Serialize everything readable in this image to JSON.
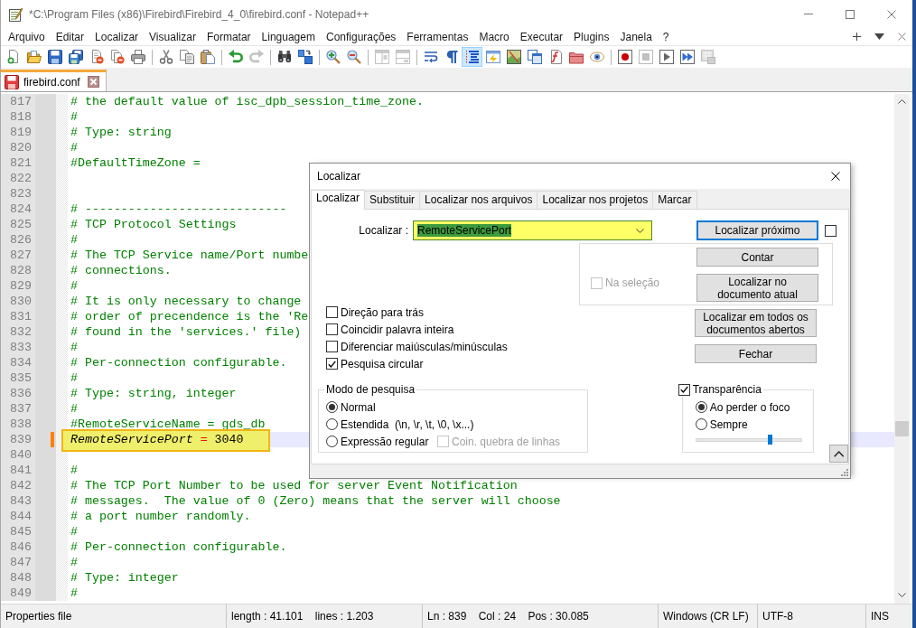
{
  "window": {
    "title": "*C:\\Program Files (x86)\\Firebird\\Firebird_4_0\\firebird.conf - Notepad++"
  },
  "menu": [
    "Arquivo",
    "Editar",
    "Localizar",
    "Visualizar",
    "Formatar",
    "Linguagem",
    "Configurações",
    "Ferramentas",
    "Macro",
    "Executar",
    "Plugins",
    "Janela",
    "?"
  ],
  "toolbar": [
    {
      "buttons": [
        {
          "kind": "new",
          "on": false,
          "disabled": false
        },
        {
          "kind": "open",
          "on": false,
          "disabled": false
        },
        {
          "kind": "save",
          "on": false,
          "disabled": false
        },
        {
          "kind": "saveall",
          "on": false,
          "disabled": false
        },
        {
          "kind": "close",
          "on": false,
          "disabled": false
        },
        {
          "kind": "closeall",
          "on": false,
          "disabled": false
        },
        {
          "kind": "print",
          "on": false,
          "disabled": false
        }
      ]
    },
    {
      "buttons": [
        {
          "kind": "cut",
          "on": false,
          "disabled": false
        },
        {
          "kind": "copy",
          "on": false,
          "disabled": false
        },
        {
          "kind": "paste",
          "on": false,
          "disabled": false
        }
      ]
    },
    {
      "buttons": [
        {
          "kind": "undo",
          "on": false,
          "disabled": false
        },
        {
          "kind": "redo",
          "on": false,
          "disabled": true
        }
      ]
    },
    {
      "buttons": [
        {
          "kind": "find",
          "on": false,
          "disabled": false
        },
        {
          "kind": "replace",
          "on": false,
          "disabled": false
        }
      ]
    },
    {
      "buttons": [
        {
          "kind": "zoomin",
          "on": false,
          "disabled": false
        },
        {
          "kind": "zoomout",
          "on": false,
          "disabled": false
        }
      ]
    },
    {
      "buttons": [
        {
          "kind": "syncv",
          "on": false,
          "disabled": true
        },
        {
          "kind": "synch",
          "on": false,
          "disabled": true
        }
      ]
    },
    {
      "buttons": [
        {
          "kind": "wrap",
          "on": false,
          "disabled": false
        },
        {
          "kind": "allchars",
          "on": false,
          "disabled": false
        },
        {
          "kind": "indent",
          "on": true,
          "disabled": false
        },
        {
          "kind": "udl",
          "on": false,
          "disabled": false
        },
        {
          "kind": "docmap",
          "on": false,
          "disabled": false
        },
        {
          "kind": "doclist",
          "on": false,
          "disabled": false
        },
        {
          "kind": "funclist",
          "on": false,
          "disabled": false
        },
        {
          "kind": "workspace",
          "on": false,
          "disabled": false
        },
        {
          "kind": "monitor",
          "on": false,
          "disabled": false
        }
      ]
    },
    {
      "buttons": [
        {
          "kind": "record",
          "on": false,
          "disabled": false
        },
        {
          "kind": "stop",
          "on": false,
          "disabled": true
        },
        {
          "kind": "play",
          "on": false,
          "disabled": false
        },
        {
          "kind": "playmulti",
          "on": false,
          "disabled": false
        },
        {
          "kind": "savemacro",
          "on": false,
          "disabled": true
        }
      ]
    }
  ],
  "doc_tabs": [
    {
      "label": "firebird.conf",
      "selected": true,
      "modified": true
    }
  ],
  "editor": {
    "lines": [
      {
        "number": "817",
        "kind": "comment",
        "text": "# the default value of isc_dpb_session_time_zone.",
        "current": false,
        "modified": false,
        "highlighted": false
      },
      {
        "number": "818",
        "kind": "comment",
        "text": "#",
        "current": false,
        "modified": false,
        "highlighted": false
      },
      {
        "number": "819",
        "kind": "comment",
        "text": "# Type: string",
        "current": false,
        "modified": false,
        "highlighted": false
      },
      {
        "number": "820",
        "kind": "comment",
        "text": "#",
        "current": false,
        "modified": false,
        "highlighted": false
      },
      {
        "number": "821",
        "kind": "comment",
        "text": "#DefaultTimeZone =",
        "current": false,
        "modified": false,
        "highlighted": false
      },
      {
        "number": "822",
        "kind": "blank",
        "current": false,
        "modified": false,
        "highlighted": false
      },
      {
        "number": "823",
        "kind": "blank",
        "current": false,
        "modified": false,
        "highlighted": false
      },
      {
        "number": "824",
        "kind": "comment",
        "text": "# ----------------------------",
        "current": false,
        "modified": false,
        "highlighted": false
      },
      {
        "number": "825",
        "kind": "comment",
        "text": "# TCP Protocol Settings",
        "current": false,
        "modified": false,
        "highlighted": false
      },
      {
        "number": "826",
        "kind": "comment",
        "text": "#",
        "current": false,
        "modified": false,
        "highlighted": false
      },
      {
        "number": "827",
        "kind": "comment",
        "text": "# The TCP Service name/Port numbe",
        "current": false,
        "modified": false,
        "highlighted": false
      },
      {
        "number": "828",
        "kind": "comment",
        "text": "# connections.",
        "current": false,
        "modified": false,
        "highlighted": false
      },
      {
        "number": "829",
        "kind": "comment",
        "text": "#",
        "current": false,
        "modified": false,
        "highlighted": false
      },
      {
        "number": "830",
        "kind": "comment",
        "text": "# It is only necessary to change",
        "current": false,
        "modified": false,
        "highlighted": false
      },
      {
        "number": "831",
        "kind": "comment",
        "text": "# order of precendence is the 'Re",
        "current": false,
        "modified": false,
        "highlighted": false
      },
      {
        "number": "832",
        "kind": "comment",
        "text": "# found in the 'services.' file)",
        "current": false,
        "modified": false,
        "highlighted": false
      },
      {
        "number": "833",
        "kind": "comment",
        "text": "#",
        "current": false,
        "modified": false,
        "highlighted": false
      },
      {
        "number": "834",
        "kind": "comment",
        "text": "# Per-connection configurable.",
        "current": false,
        "modified": false,
        "highlighted": false
      },
      {
        "number": "835",
        "kind": "comment",
        "text": "#",
        "current": false,
        "modified": false,
        "highlighted": false
      },
      {
        "number": "836",
        "kind": "comment",
        "text": "# Type: string, integer",
        "current": false,
        "modified": false,
        "highlighted": false
      },
      {
        "number": "837",
        "kind": "comment",
        "text": "#",
        "current": false,
        "modified": false,
        "highlighted": false
      },
      {
        "number": "838",
        "kind": "comment",
        "text": "#RemoteServiceName = gds_db",
        "current": false,
        "modified": false,
        "highlighted": false
      },
      {
        "number": "839",
        "kind": "property",
        "parts": [
          {
            "kind": "key",
            "text": "RemoteServicePort"
          },
          {
            "kind": "operator",
            "text": " = "
          },
          {
            "kind": "value",
            "text": "3040"
          }
        ],
        "current": true,
        "modified": true,
        "highlighted": true
      },
      {
        "number": "840",
        "kind": "blank",
        "current": false,
        "modified": false,
        "highlighted": false
      },
      {
        "number": "841",
        "kind": "comment",
        "text": "#",
        "current": false,
        "modified": false,
        "highlighted": false
      },
      {
        "number": "842",
        "kind": "comment",
        "text": "# The TCP Port Number to be used for server Event Notification",
        "current": false,
        "modified": false,
        "highlighted": false
      },
      {
        "number": "843",
        "kind": "comment",
        "text": "# messages.  The value of 0 (Zero) means that the server will choose",
        "current": false,
        "modified": false,
        "highlighted": false
      },
      {
        "number": "844",
        "kind": "comment",
        "text": "# a port number randomly.",
        "current": false,
        "modified": false,
        "highlighted": false
      },
      {
        "number": "845",
        "kind": "comment",
        "text": "#",
        "current": false,
        "modified": false,
        "highlighted": false
      },
      {
        "number": "846",
        "kind": "comment",
        "text": "# Per-connection configurable.",
        "current": false,
        "modified": false,
        "highlighted": false
      },
      {
        "number": "847",
        "kind": "comment",
        "text": "#",
        "current": false,
        "modified": false,
        "highlighted": false
      },
      {
        "number": "848",
        "kind": "comment",
        "text": "# Type: integer",
        "current": false,
        "modified": false,
        "highlighted": false
      },
      {
        "number": "849",
        "kind": "comment",
        "text": "#",
        "current": false,
        "modified": false,
        "highlighted": false
      }
    ]
  },
  "find_dialog": {
    "title": "Localizar",
    "tabs": [
      {
        "label": "Localizar",
        "selected": true
      },
      {
        "label": "Substituir",
        "selected": false
      },
      {
        "label": "Localizar nos arquivos",
        "selected": false
      },
      {
        "label": "Localizar nos projetos",
        "selected": false
      },
      {
        "label": "Marcar",
        "selected": false
      }
    ],
    "search": {
      "label": "Localizar :",
      "value": "RemoteServicePort",
      "text_selected": true
    },
    "two_button_mode": {
      "checked": false
    },
    "in_selection": {
      "label": "Na seleção",
      "checked": false,
      "disabled": true
    },
    "buttons": {
      "find_next": {
        "label": "Localizar próximo",
        "default": true
      },
      "count": {
        "label": "Contar",
        "default": false
      },
      "find_all_current": {
        "label": "Localizar no documento atual",
        "default": false
      },
      "find_all_open": {
        "label": "Localizar em todos os documentos abertos",
        "default": false
      },
      "close": {
        "label": "Fechar",
        "default": false
      }
    },
    "options": [
      {
        "label": "Direção para trás",
        "checked": false
      },
      {
        "label": "Coincidir palavra inteira",
        "checked": false
      },
      {
        "label": "Diferenciar maiúsculas/minúsculas",
        "checked": false
      },
      {
        "label": "Pesquisa circular",
        "checked": true
      }
    ],
    "search_mode": {
      "title": "Modo de pesquisa",
      "options": [
        {
          "label": "Normal",
          "selected": true
        },
        {
          "label": "Estendida  (\\n, \\r, \\t, \\0, \\x...)",
          "selected": false
        },
        {
          "label": "Expressão regular",
          "selected": false
        }
      ],
      "match_newline": {
        "label": "Coin. quebra de linhas",
        "checked": false,
        "disabled": true
      }
    },
    "transparency": {
      "label": "Transparência",
      "checked": true,
      "options": [
        {
          "label": "Ao perder o foco",
          "selected": true
        },
        {
          "label": "Sempre",
          "selected": false
        }
      ],
      "level": 0.7
    }
  },
  "status_bar": [
    "Properties file",
    "length : 41.101    lines : 1.203",
    "Ln : 839    Col : 24    Pos : 30.085",
    "Windows (CR LF)",
    "UTF-8",
    "INS"
  ]
}
